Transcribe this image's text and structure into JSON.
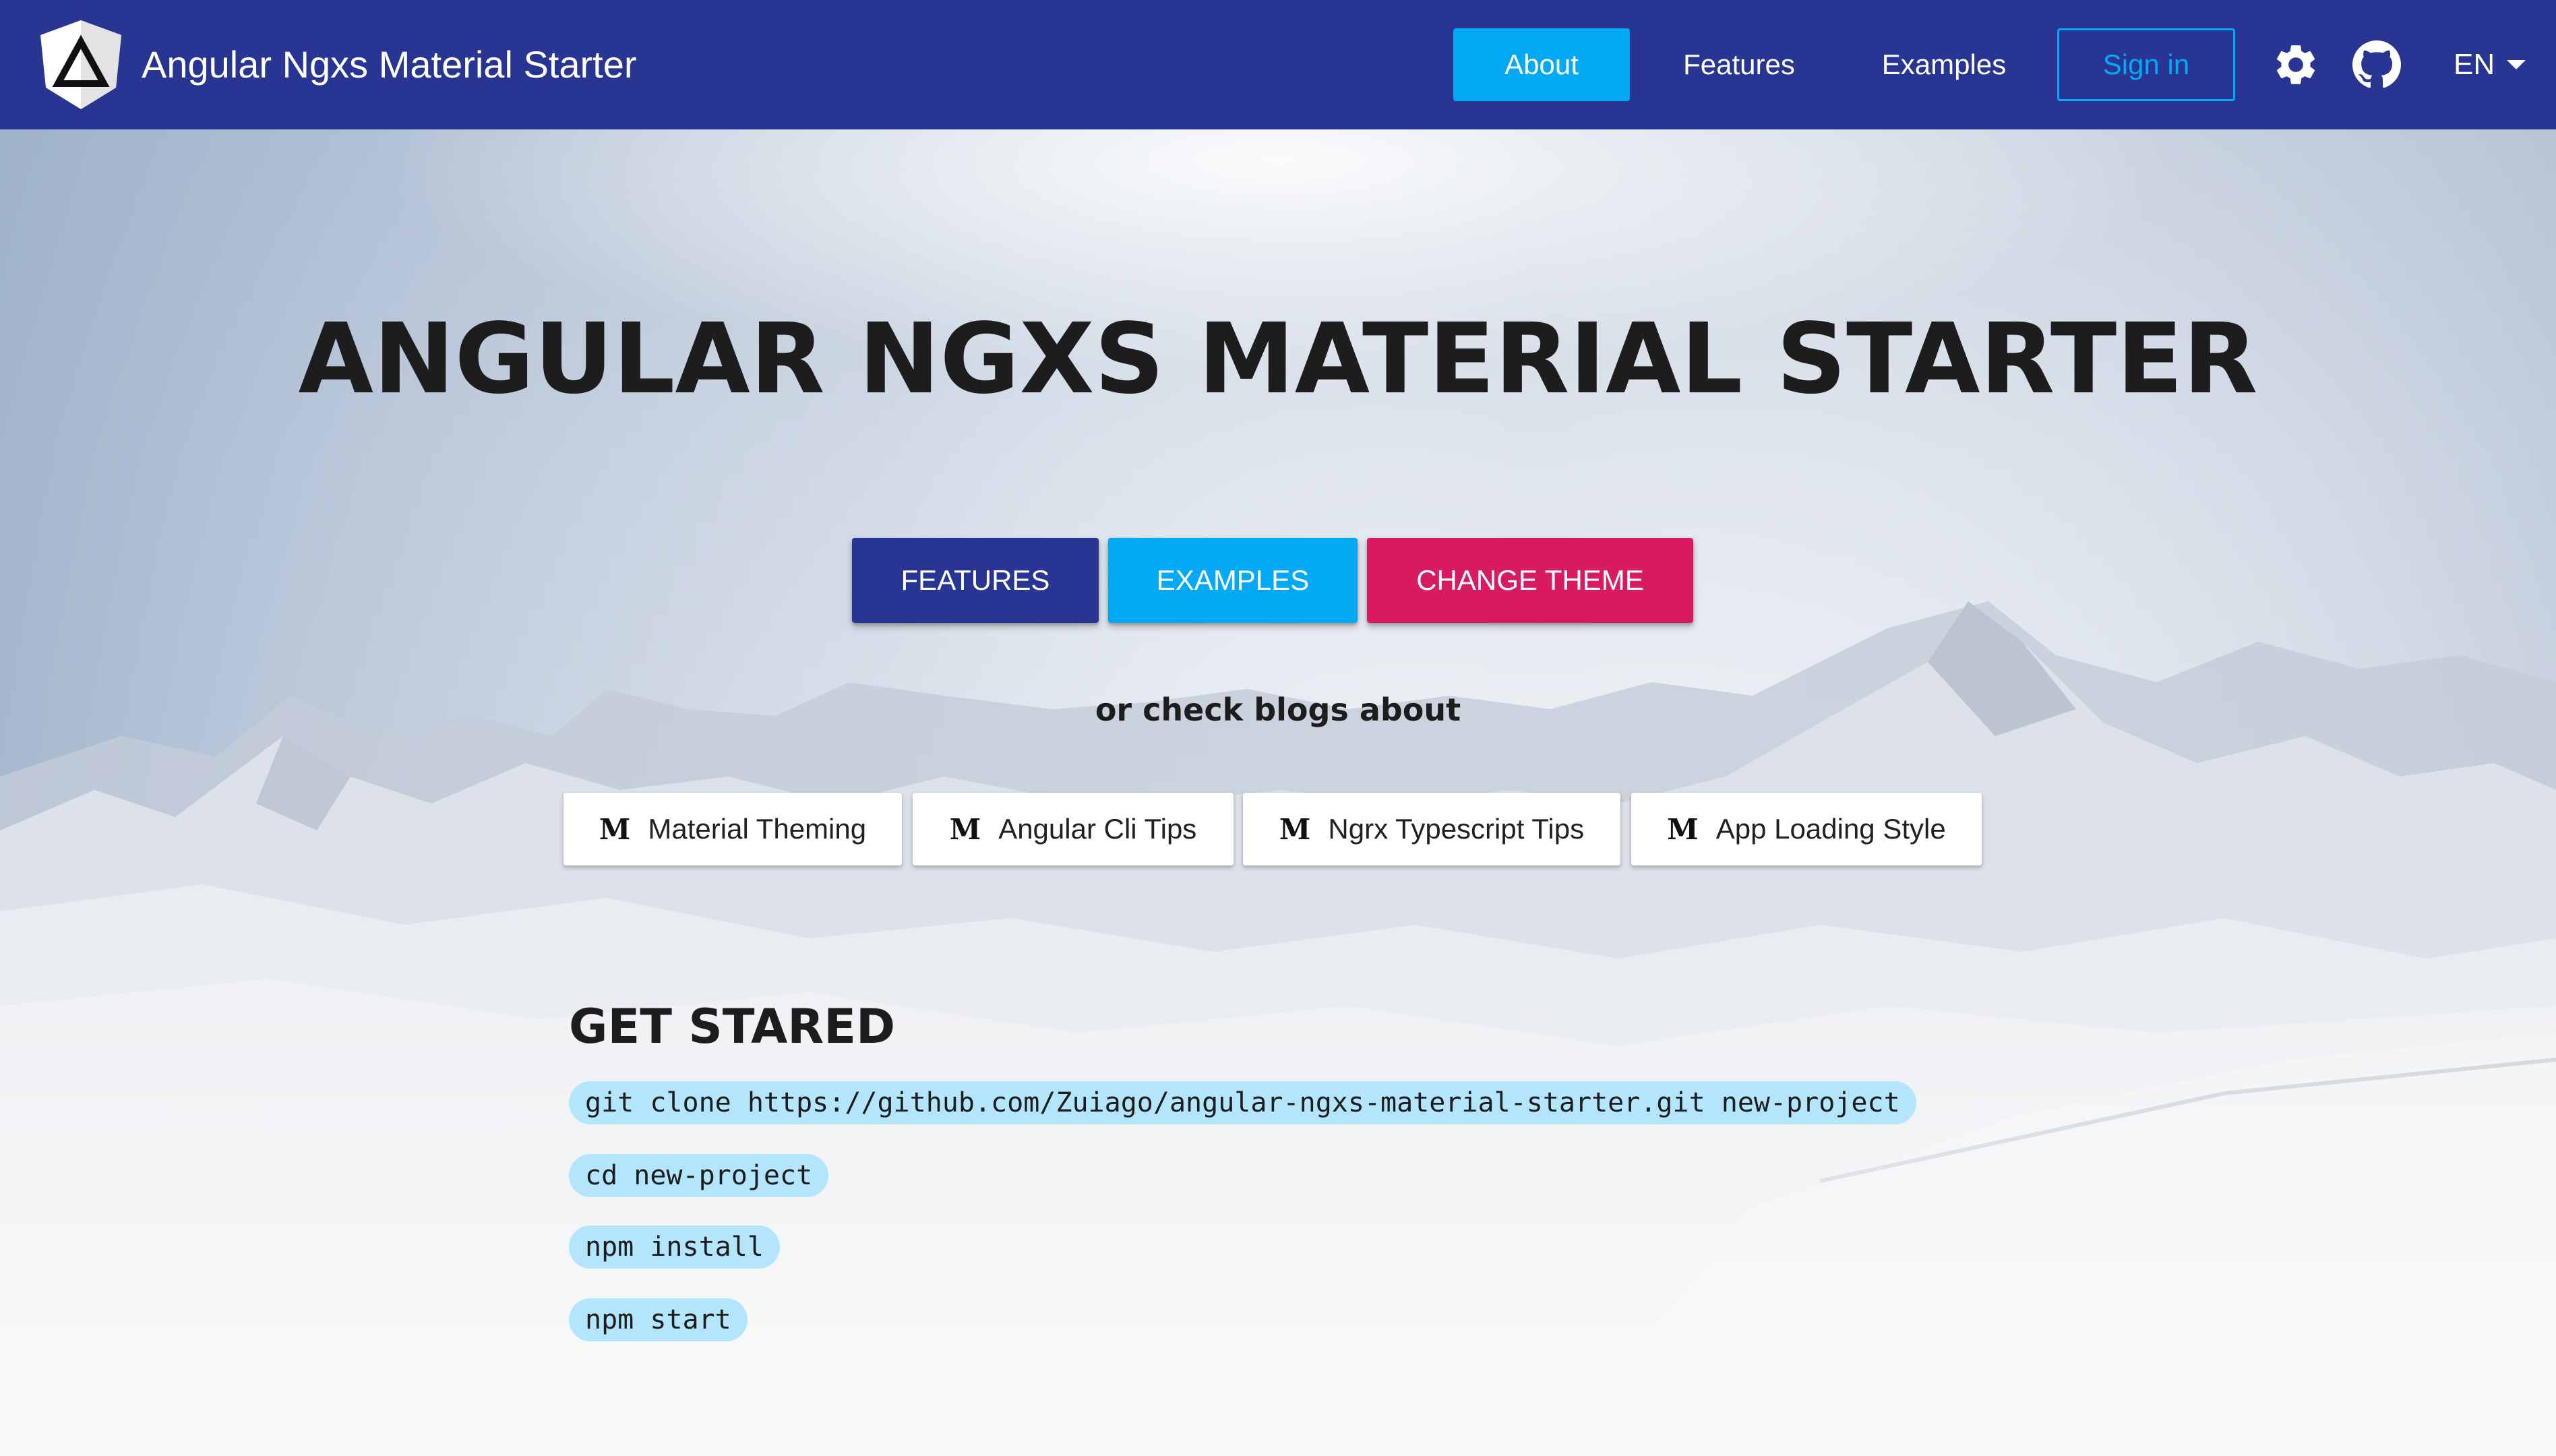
{
  "toolbar": {
    "title": "Angular Ngxs Material Starter",
    "nav": {
      "about": "About",
      "features": "Features",
      "examples": "Examples",
      "sign_in": "Sign in"
    },
    "language": "EN",
    "icons": [
      "angular-logo-icon",
      "gear-icon",
      "github-icon",
      "caret-down-icon"
    ]
  },
  "hero": {
    "title": "ANGULAR NGXS MATERIAL STARTER",
    "buttons": {
      "features": "FEATURES",
      "examples": "EXAMPLES",
      "change_theme": "CHANGE THEME"
    },
    "blogs_label": "or check blogs about",
    "blogs": [
      {
        "icon": "M",
        "label": "Material Theming"
      },
      {
        "icon": "M",
        "label": "Angular Cli Tips"
      },
      {
        "icon": "M",
        "label": "Ngrx Typescript Tips"
      },
      {
        "icon": "M",
        "label": "App Loading Style"
      }
    ]
  },
  "get_started": {
    "heading": "GET STARED",
    "commands": [
      "git clone https://github.com/Zuiago/angular-ngxs-material-starter.git new-project",
      "cd new-project",
      "npm install",
      "npm start"
    ]
  },
  "colors": {
    "primary": "#283593",
    "accent": "#03a9f4",
    "warn": "#d81b60",
    "code_background": "#b3e5fc"
  }
}
